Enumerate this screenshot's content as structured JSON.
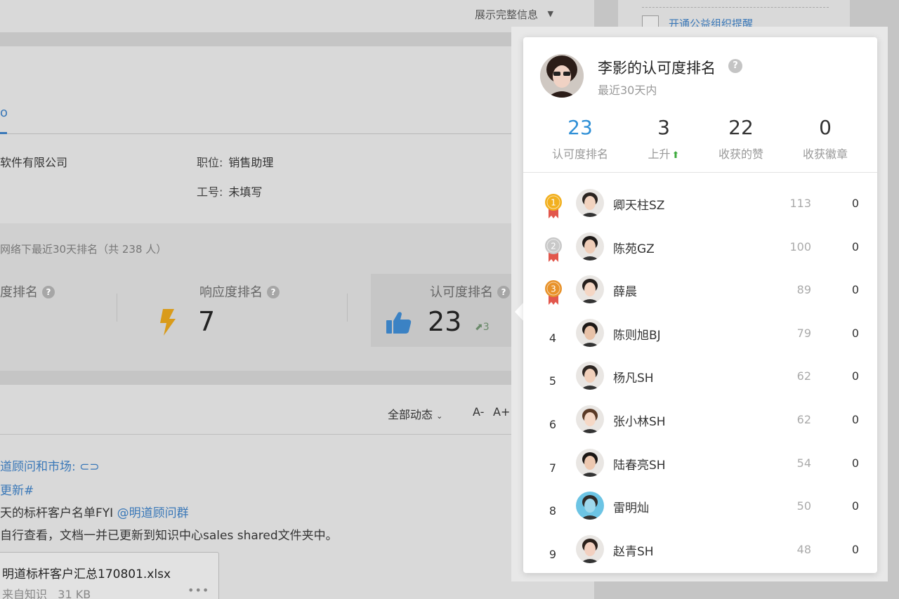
{
  "background": {
    "expand_label": "展示完整信息",
    "caret": "▼",
    "remind_label": "开通公益组织提醒",
    "tab_fragment": "o",
    "company_fragment": "软件有限公司",
    "position_key": "职位:",
    "position_value": "销售助理",
    "employee_id_key": "工号:",
    "employee_id_value": "未填写",
    "rank_header": "网络下最近30天排名（共 238 人）",
    "rank_titles": [
      "度排名",
      "响应度排名",
      "认可度排名"
    ],
    "response_value": "7",
    "approval_value": "23",
    "approval_rise": "3",
    "rise_arrow": "⬈",
    "feed_filter": "全部动态",
    "font_small": "A-",
    "font_large": "A+",
    "feed_lines": [
      "道顾问和市场:",
      "更新#",
      "天的标杆客户名单FYI",
      "@明道顾问群",
      "自行查看，文档一并已更新到知识中心sales shared文件夹中。"
    ],
    "file_name": "明道标杆客户汇总170801.xlsx",
    "file_source": "来自知识",
    "file_size": "31 KB",
    "file_more": "•••",
    "question_mark": "?"
  },
  "popover": {
    "title": "李影的认可度排名",
    "subtitle": "最近30天内",
    "question_mark": "?",
    "stats": [
      {
        "value": "23",
        "label": "认可度排名"
      },
      {
        "value": "3",
        "label": "上升"
      },
      {
        "value": "22",
        "label": "收获的赞"
      },
      {
        "value": "0",
        "label": "收获徽章"
      }
    ],
    "up_arrow": "⬆",
    "ranking": [
      {
        "rank": "1",
        "name": "卿天柱SZ",
        "score": "113",
        "badges": "0",
        "medal": "gold"
      },
      {
        "rank": "2",
        "name": "陈苑GZ",
        "score": "100",
        "badges": "0",
        "medal": "silver"
      },
      {
        "rank": "3",
        "name": "薛晨",
        "score": "89",
        "badges": "0",
        "medal": "bronze"
      },
      {
        "rank": "4",
        "name": "陈则旭BJ",
        "score": "79",
        "badges": "0"
      },
      {
        "rank": "5",
        "name": "杨凡SH",
        "score": "62",
        "badges": "0"
      },
      {
        "rank": "6",
        "name": "张小林SH",
        "score": "62",
        "badges": "0"
      },
      {
        "rank": "7",
        "name": "陆春亮SH",
        "score": "54",
        "badges": "0"
      },
      {
        "rank": "8",
        "name": "雷明灿",
        "score": "50",
        "badges": "0"
      },
      {
        "rank": "9",
        "name": "赵青SH",
        "score": "48",
        "badges": "0"
      }
    ]
  },
  "colors": {
    "accent": "#2e8fd6",
    "link": "#3a78b8",
    "rise_green": "#3daa3d",
    "gold": "#f2b01e",
    "silver": "#c9c9c9",
    "bronze": "#e8922a",
    "ribbon": "#e2574c"
  }
}
